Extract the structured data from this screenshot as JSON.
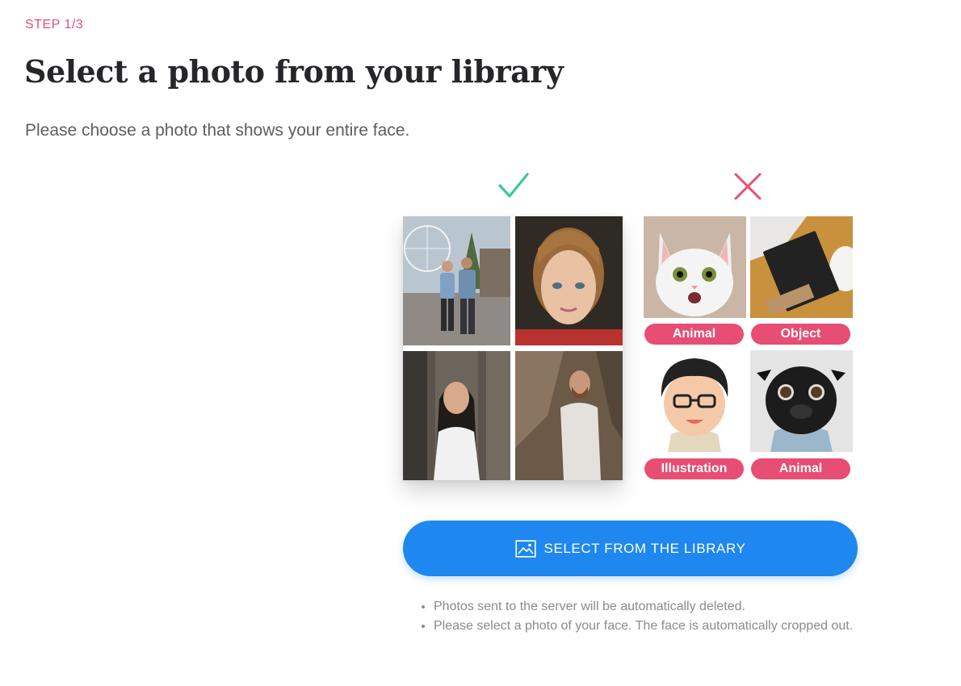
{
  "header": {
    "step": "STEP 1/3",
    "title": "Select a photo from your library",
    "subtitle": "Please choose a photo that shows your entire face."
  },
  "examples": {
    "good_icon": "checkmark-icon",
    "bad_icon": "cross-icon",
    "bad_labels": [
      "Animal",
      "Object",
      "Illustration",
      "Animal"
    ]
  },
  "action": {
    "label": "SELECT FROM THE LIBRARY",
    "icon": "image-icon"
  },
  "notes": [
    "Photos sent to the server will be automatically deleted.",
    "Please select a photo of your face. The face is automatically cropped out."
  ],
  "colors": {
    "accent_pink": "#e84d73",
    "step_pink": "#e0507a",
    "button_blue": "#1e88f0",
    "check_green": "#3cc79a"
  }
}
